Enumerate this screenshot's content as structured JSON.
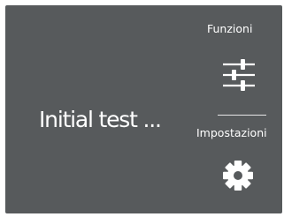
{
  "screen": {
    "background": "#575a5c",
    "text_color": "#ffffff",
    "status_text": "Initial test ..."
  },
  "side_menu": {
    "functions": {
      "label": "Funzioni",
      "icon": "sliders-icon"
    },
    "settings": {
      "label": "Impostazioni",
      "icon": "gear-icon"
    }
  }
}
